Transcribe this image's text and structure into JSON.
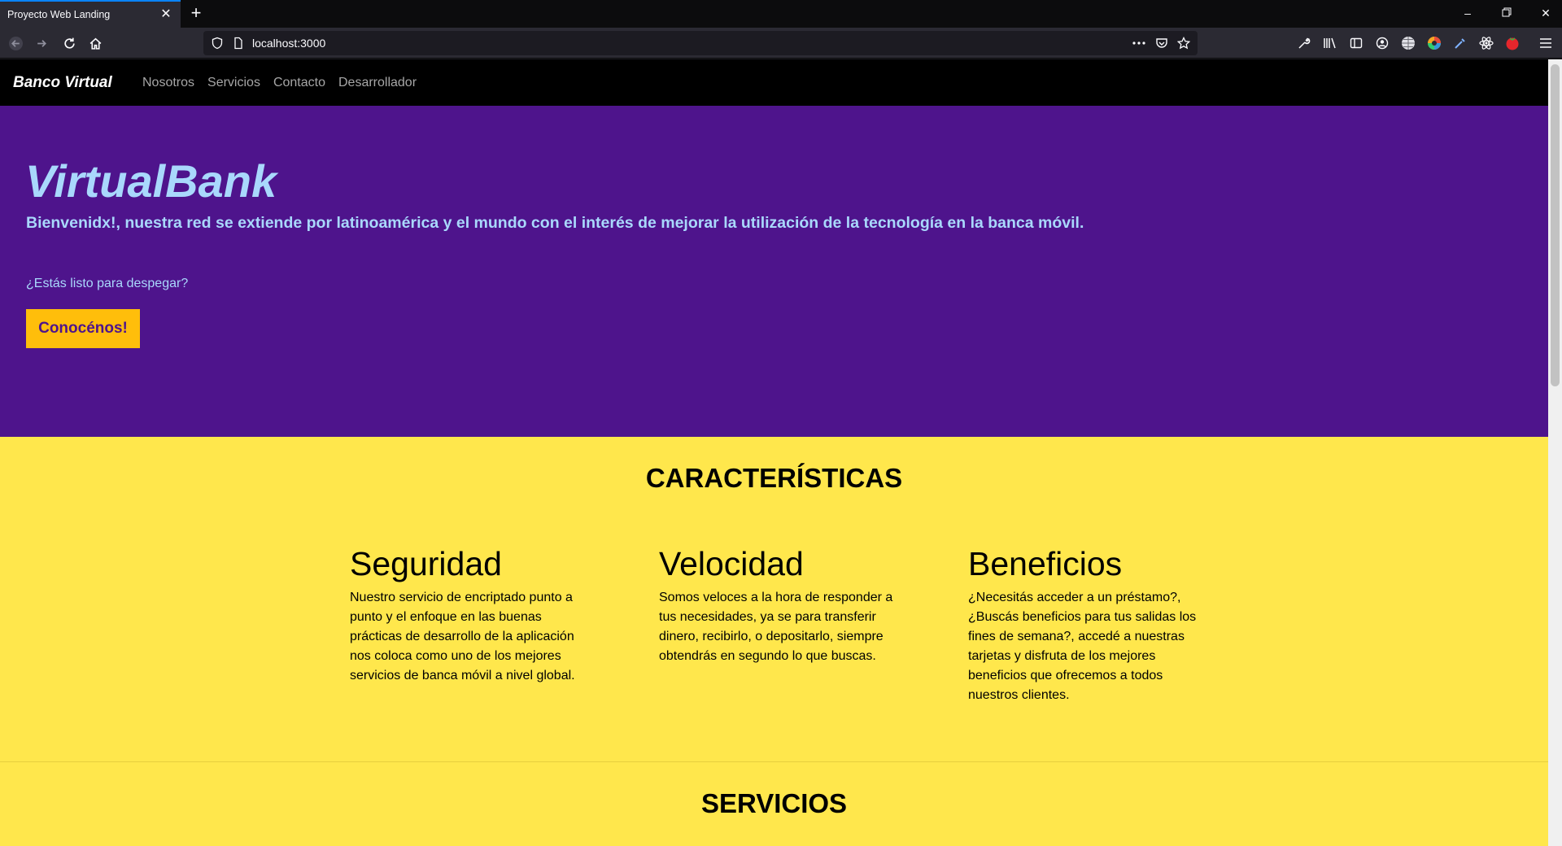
{
  "browser": {
    "tab_title": "Proyecto Web Landing",
    "url": "localhost:3000"
  },
  "site": {
    "brand": "Banco Virtual",
    "nav_links": [
      "Nosotros",
      "Servicios",
      "Contacto",
      "Desarrollador"
    ]
  },
  "hero": {
    "title": "VirtualBank",
    "lead": "Bienvenidx!, nuestra red se extiende por latinoamérica y el mundo con el interés de mejorar la utilización de la tecnología en la banca móvil.",
    "question": "¿Estás listo para despegar?",
    "button_label": "Conocénos!"
  },
  "features": {
    "title": "CARACTERÍSTICAS",
    "items": [
      {
        "title": "Seguridad",
        "text": "Nuestro servicio de encriptado punto a punto y el enfoque en las buenas prácticas de desarrollo de la aplicación nos coloca como uno de los mejores servicios de banca móvil a nivel global."
      },
      {
        "title": "Velocidad",
        "text": "Somos veloces a la hora de responder a tus necesidades, ya se para transferir dinero, recibirlo, o depositarlo, siempre obtendrás en segundo lo que buscas."
      },
      {
        "title": "Beneficios",
        "text": "¿Necesitás acceder a un préstamo?, ¿Buscás beneficios para tus salidas los fines de semana?, accedé a nuestras tarjetas y disfruta de los mejores beneficios que ofrecemos a todos nuestros clientes."
      }
    ]
  },
  "services": {
    "title": "SERVICIOS"
  },
  "colors": {
    "hero_bg": "#4e148c",
    "hero_text": "#a9d8fc",
    "page_bg": "#ffe74c",
    "button_bg": "#ffbe0b",
    "nav_bg": "#000000"
  }
}
